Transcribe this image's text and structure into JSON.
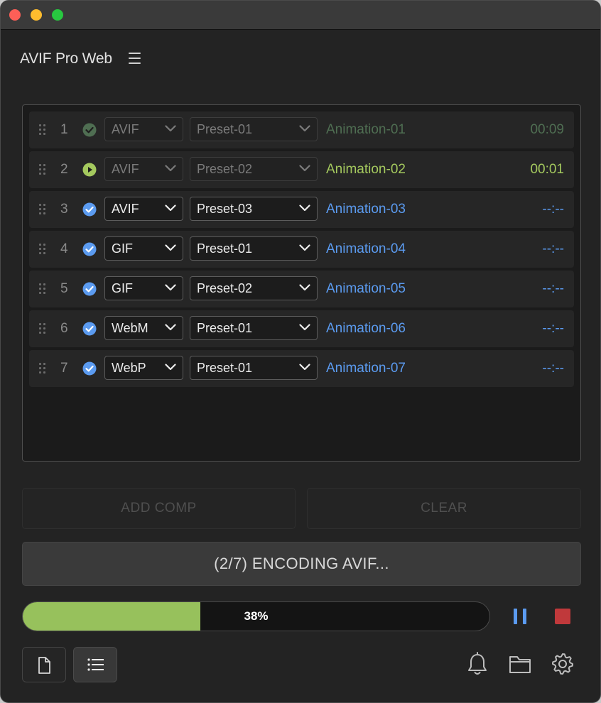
{
  "app": {
    "title": "AVIF Pro Web"
  },
  "icons": {
    "menu": "hamburger-menu-icon",
    "drag": "drag-handle-icon",
    "done": "check-circle-icon",
    "encoding": "play-circle-icon",
    "queued": "check-circle-icon",
    "dropdown": "chevron-down-icon",
    "pause": "pause-icon",
    "stop": "stop-icon",
    "single": "document-icon",
    "batch": "list-icon",
    "notifications": "bell-icon",
    "folder": "folder-icon",
    "settings": "gear-icon"
  },
  "colors": {
    "done": "#4f6e52",
    "encoding": "#a4c95e",
    "queued": "#5b9bf0",
    "progress_fill": "#97c15c",
    "stop": "#c0393b"
  },
  "queue": {
    "rows": [
      {
        "index": "1",
        "status": "done",
        "format": "AVIF",
        "preset": "Preset-01",
        "name": "Animation-01",
        "time": "00:09"
      },
      {
        "index": "2",
        "status": "encoding",
        "format": "AVIF",
        "preset": "Preset-02",
        "name": "Animation-02",
        "time": "00:01"
      },
      {
        "index": "3",
        "status": "queued",
        "format": "AVIF",
        "preset": "Preset-03",
        "name": "Animation-03",
        "time": "--:--"
      },
      {
        "index": "4",
        "status": "queued",
        "format": "GIF",
        "preset": "Preset-01",
        "name": "Animation-04",
        "time": "--:--"
      },
      {
        "index": "5",
        "status": "queued",
        "format": "GIF",
        "preset": "Preset-02",
        "name": "Animation-05",
        "time": "--:--"
      },
      {
        "index": "6",
        "status": "queued",
        "format": "WebM",
        "preset": "Preset-01",
        "name": "Animation-06",
        "time": "--:--"
      },
      {
        "index": "7",
        "status": "queued",
        "format": "WebP",
        "preset": "Preset-01",
        "name": "Animation-07",
        "time": "--:--"
      }
    ]
  },
  "actions": {
    "add_comp": "ADD COMP",
    "clear": "CLEAR",
    "encode_status": "(2/7) ENCODING AVIF..."
  },
  "progress": {
    "value": 0.38,
    "label": "38%"
  }
}
